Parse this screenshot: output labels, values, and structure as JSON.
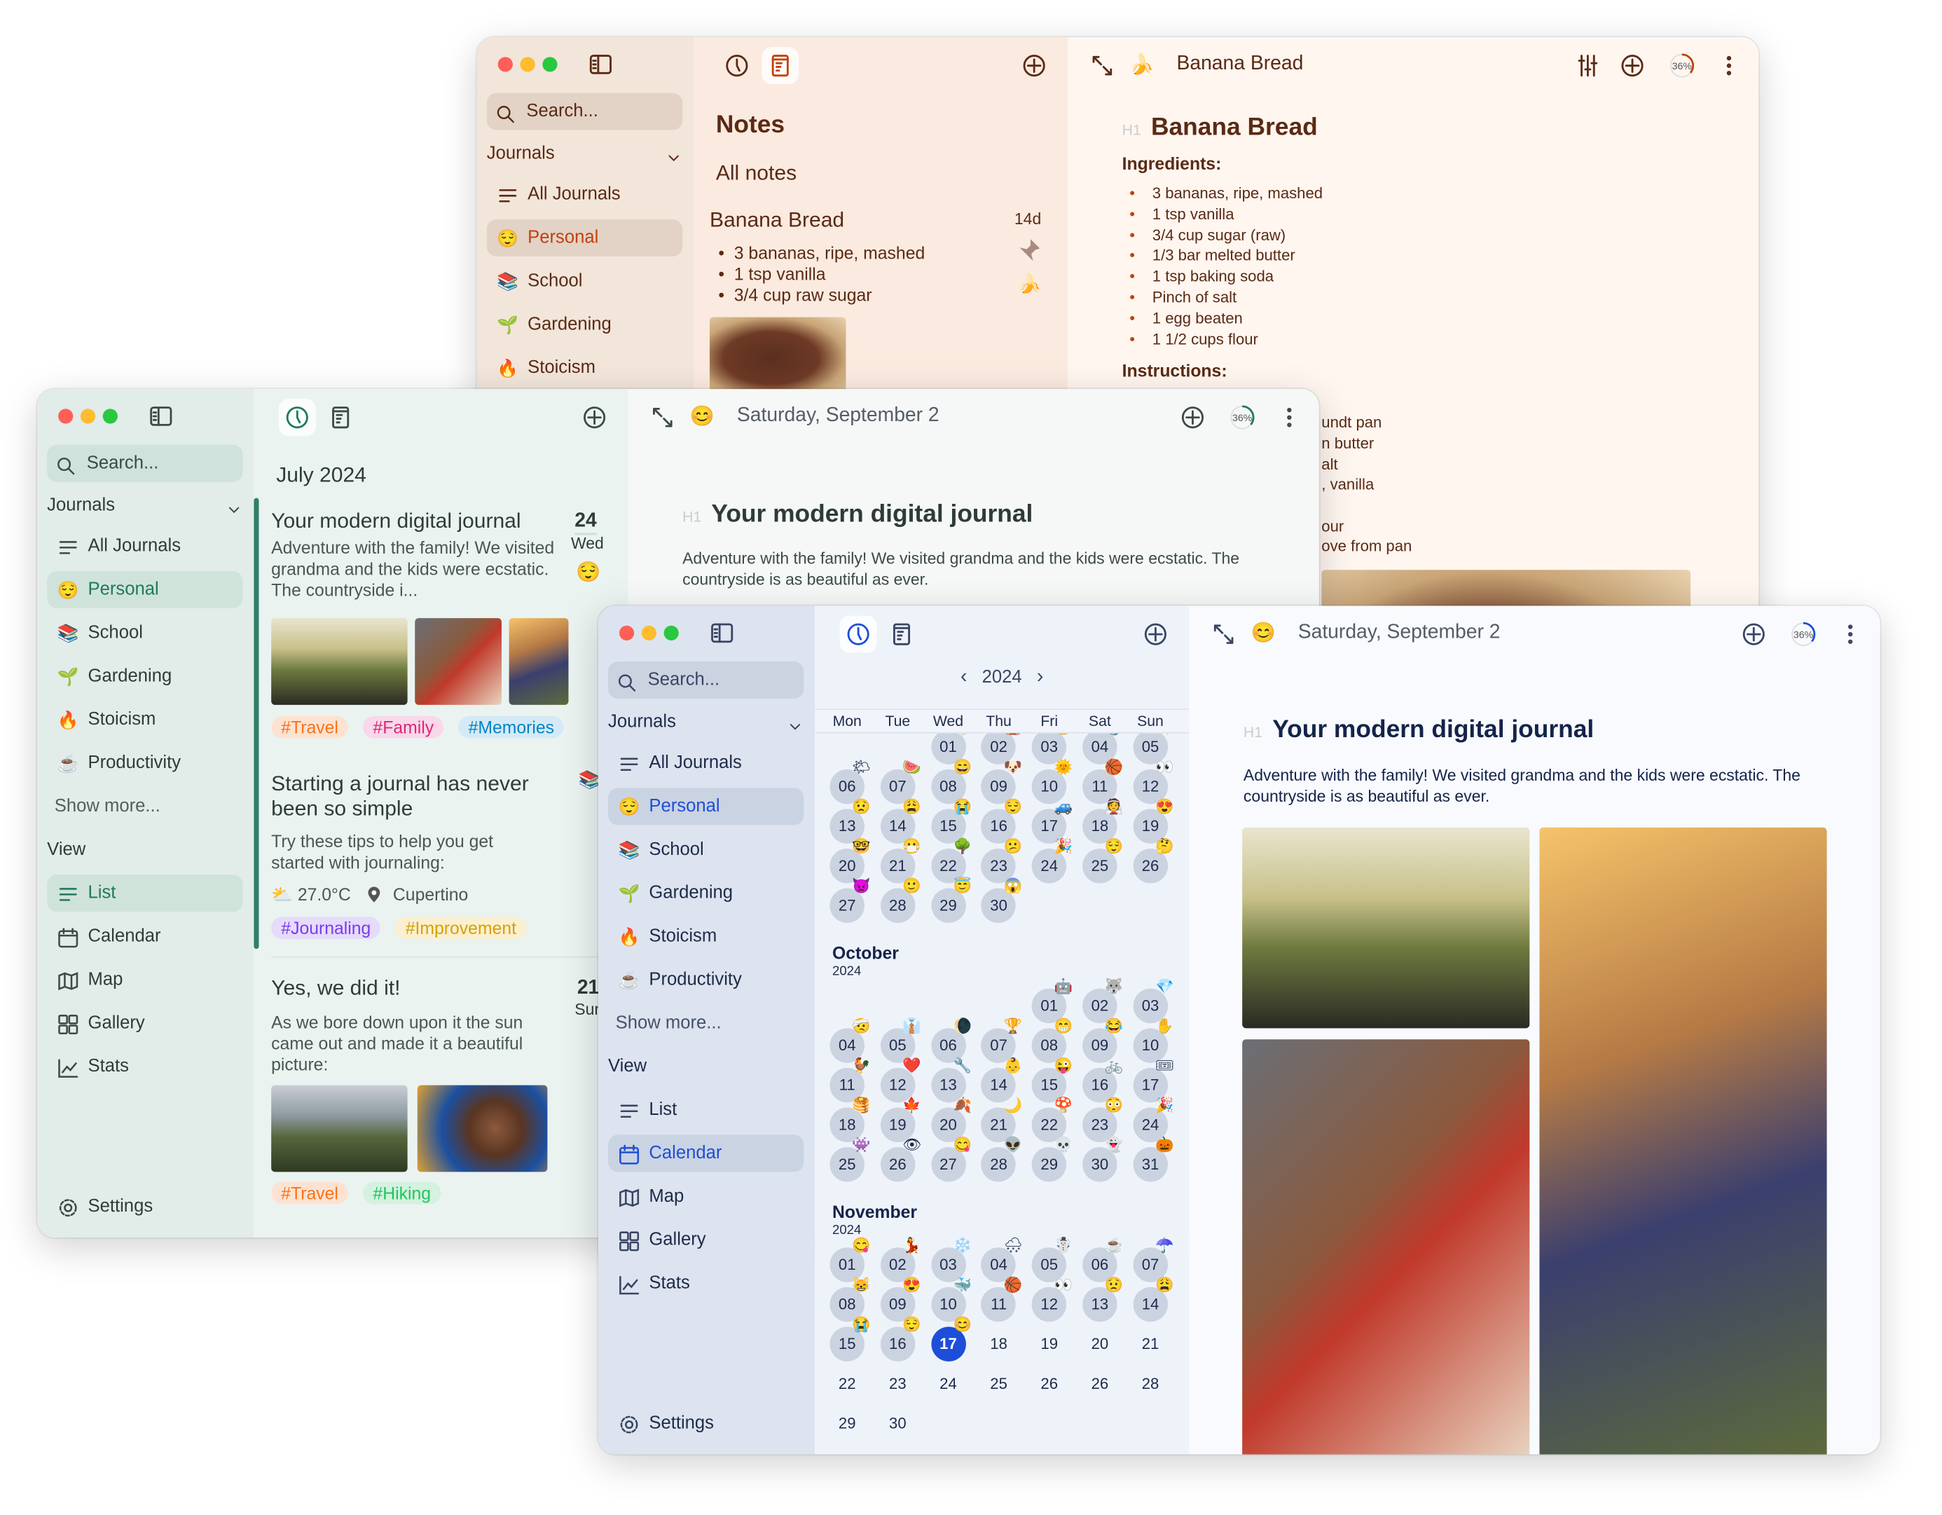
{
  "colors": {
    "brown_accent": "#c2410c",
    "green_accent": "#1f7a5c",
    "blue_accent": "#1d4ed8",
    "traffic_red": "#fe5f57",
    "traffic_yellow": "#febc2e",
    "traffic_green": "#28c840"
  },
  "windows": {
    "notes": {
      "sidebar": {
        "search_placeholder": "Search...",
        "journals_header": "Journals",
        "journals": [
          {
            "label": "All Journals",
            "icon": "list-icon"
          },
          {
            "label": "Personal",
            "icon": "😌",
            "selected": true
          },
          {
            "label": "School",
            "icon": "📚"
          },
          {
            "label": "Gardening",
            "icon": "🌱"
          },
          {
            "label": "Stoicism",
            "icon": "🔥"
          }
        ]
      },
      "middle": {
        "active_tab": "notes",
        "title": "Notes",
        "subtitle": "All notes",
        "note": {
          "title": "Banana Bread",
          "age": "14d",
          "emoji": "🍌",
          "pinned": true,
          "bullets": [
            "3 bananas, ripe, mashed",
            "1 tsp vanilla",
            "3/4 cup raw sugar"
          ]
        }
      },
      "editor": {
        "emoji": "🍌",
        "title": "Banana Bread",
        "progress_label": "36%",
        "progress": 36,
        "h1_marker": "H1",
        "heading": "Banana Bread",
        "ingredients_label": "Ingredients:",
        "ingredients": [
          "3 bananas, ripe, mashed",
          "1 tsp vanilla",
          "3/4 cup sugar (raw)",
          "1/3 bar melted butter",
          "1 tsp baking soda",
          "Pinch of salt",
          "1 egg beaten",
          "1 1/2 cups flour"
        ],
        "instructions_label": "Instructions:",
        "instruction_fragments": [
          "undt pan",
          "n butter",
          "alt",
          ", vanilla",
          "our",
          "ove from pan"
        ]
      }
    },
    "journal": {
      "sidebar": {
        "search_placeholder": "Search...",
        "journals_header": "Journals",
        "journals": [
          {
            "label": "All Journals",
            "icon": "list-icon"
          },
          {
            "label": "Personal",
            "icon": "😌",
            "selected": true
          },
          {
            "label": "School",
            "icon": "📚"
          },
          {
            "label": "Gardening",
            "icon": "🌱"
          },
          {
            "label": "Stoicism",
            "icon": "🔥"
          },
          {
            "label": "Productivity",
            "icon": "☕"
          }
        ],
        "show_more": "Show more...",
        "view_header": "View",
        "views": [
          {
            "label": "List",
            "icon": "list-icon",
            "selected": true
          },
          {
            "label": "Calendar",
            "icon": "calendar-icon"
          },
          {
            "label": "Map",
            "icon": "map-icon"
          },
          {
            "label": "Gallery",
            "icon": "gallery-icon"
          },
          {
            "label": "Stats",
            "icon": "stats-icon"
          }
        ],
        "settings": "Settings"
      },
      "middle": {
        "active_tab": "timeline",
        "month_header": "July 2024",
        "entries": [
          {
            "title": "Your modern digital journal",
            "day": "24",
            "weekday": "Wed",
            "mood": "😌",
            "body": "Adventure with the family! We visited grandma and the kids were ecstatic. The countryside i...",
            "photos": [
              "father-daughter",
              "grandma-baking",
              "girls-reading"
            ],
            "tags": [
              {
                "label": "#Travel",
                "color": "#f97316",
                "bg": "#fde2d2"
              },
              {
                "label": "#Family",
                "color": "#db2777",
                "bg": "#f8d8ea"
              },
              {
                "label": "#Memories",
                "color": "#0284c7",
                "bg": "#d4eaf6"
              }
            ]
          },
          {
            "title": "Starting a journal has never been so simple",
            "mood": "📚",
            "body": "Try these tips to help you get started with journaling:",
            "weather": "27.0°C",
            "location": "Cupertino",
            "tags": [
              {
                "label": "#Journaling",
                "color": "#7c3aed",
                "bg": "#e5dbfa"
              },
              {
                "label": "#Improvement",
                "color": "#d4a106",
                "bg": "#faf0d0"
              }
            ]
          },
          {
            "title": "Yes, we did it!",
            "day": "21",
            "weekday": "Sun",
            "body": "As we bore down upon it the sun came out and made it a beautiful picture:",
            "photos": [
              "hikers-mountains",
              "smiling-woman"
            ],
            "tags": [
              {
                "label": "#Travel",
                "color": "#f97316",
                "bg": "#fde2d2"
              },
              {
                "label": "#Hiking",
                "color": "#22c55e",
                "bg": "#d3f2df"
              }
            ]
          }
        ]
      },
      "editor": {
        "emoji": "😊",
        "title": "Saturday, September 2",
        "progress_label": "36%",
        "progress": 36,
        "h1_marker": "H1",
        "heading": "Your modern digital journal",
        "body": "Adventure with the family! We visited grandma and the kids were ecstatic. The countryside is as beautiful as ever."
      }
    },
    "calendar": {
      "sidebar": {
        "search_placeholder": "Search...",
        "journals_header": "Journals",
        "journals": [
          {
            "label": "All Journals",
            "icon": "list-icon"
          },
          {
            "label": "Personal",
            "icon": "😌",
            "selected": true
          },
          {
            "label": "School",
            "icon": "📚"
          },
          {
            "label": "Gardening",
            "icon": "🌱"
          },
          {
            "label": "Stoicism",
            "icon": "🔥"
          },
          {
            "label": "Productivity",
            "icon": "☕"
          }
        ],
        "show_more": "Show more...",
        "view_header": "View",
        "views": [
          {
            "label": "List",
            "icon": "list-icon"
          },
          {
            "label": "Calendar",
            "icon": "calendar-icon",
            "selected": true
          },
          {
            "label": "Map",
            "icon": "map-icon"
          },
          {
            "label": "Gallery",
            "icon": "gallery-icon"
          },
          {
            "label": "Stats",
            "icon": "stats-icon"
          }
        ],
        "settings": "Settings"
      },
      "middle": {
        "active_tab": "timeline",
        "year": "2024",
        "weekdays": [
          "Mon",
          "Tue",
          "Wed",
          "Thu",
          "Fri",
          "Sat",
          "Sun"
        ],
        "months": [
          {
            "name": "",
            "year": "",
            "first_weekday": "Wed",
            "days": [
              {
                "label": "01",
                "emoji": "🥛"
              },
              {
                "label": "02",
                "emoji": "🎪"
              },
              {
                "label": "03",
                "emoji": "😯"
              },
              {
                "label": "04",
                "emoji": "⚓"
              },
              {
                "label": "05",
                "emoji": "✨"
              },
              {
                "label": "06",
                "emoji": "🌤"
              },
              {
                "label": "07",
                "emoji": "🍉"
              },
              {
                "label": "08",
                "emoji": "😄"
              },
              {
                "label": "09",
                "emoji": "🐶"
              },
              {
                "label": "10",
                "emoji": "🌞"
              },
              {
                "label": "11",
                "emoji": "🏀"
              },
              {
                "label": "12",
                "emoji": "👀"
              },
              {
                "label": "13",
                "emoji": "😟"
              },
              {
                "label": "14",
                "emoji": "😩"
              },
              {
                "label": "15",
                "emoji": "😭"
              },
              {
                "label": "16",
                "emoji": "😌"
              },
              {
                "label": "17",
                "emoji": "🚙"
              },
              {
                "label": "18",
                "emoji": "👰"
              },
              {
                "label": "19",
                "emoji": "😍"
              },
              {
                "label": "20",
                "emoji": "🤓"
              },
              {
                "label": "21",
                "emoji": "😷"
              },
              {
                "label": "22",
                "emoji": "🌳"
              },
              {
                "label": "23",
                "emoji": "😕"
              },
              {
                "label": "24",
                "emoji": "🎉"
              },
              {
                "label": "25",
                "emoji": "😌"
              },
              {
                "label": "26",
                "emoji": "🤔"
              },
              {
                "label": "27",
                "emoji": "👿"
              },
              {
                "label": "28",
                "emoji": "🙂"
              },
              {
                "label": "29",
                "emoji": "😇"
              },
              {
                "label": "30",
                "emoji": "😱"
              }
            ]
          },
          {
            "name": "October",
            "year": "2024",
            "first_weekday": "Fri",
            "days": [
              {
                "label": "01",
                "emoji": "🤖"
              },
              {
                "label": "02",
                "emoji": "🐺"
              },
              {
                "label": "03",
                "emoji": "💎"
              },
              {
                "label": "04",
                "emoji": "🤕"
              },
              {
                "label": "05",
                "emoji": "👔"
              },
              {
                "label": "06",
                "emoji": "🌘"
              },
              {
                "label": "07",
                "emoji": "🏆"
              },
              {
                "label": "08",
                "emoji": "😁"
              },
              {
                "label": "09",
                "emoji": "😂"
              },
              {
                "label": "10",
                "emoji": "✋"
              },
              {
                "label": "11",
                "emoji": "🐓"
              },
              {
                "label": "12",
                "emoji": "❤️"
              },
              {
                "label": "13",
                "emoji": "🔧"
              },
              {
                "label": "14",
                "emoji": "👶"
              },
              {
                "label": "15",
                "emoji": "😜"
              },
              {
                "label": "16",
                "emoji": "🚲"
              },
              {
                "label": "17",
                "emoji": "🎟"
              },
              {
                "label": "18",
                "emoji": "🥞"
              },
              {
                "label": "19",
                "emoji": "🍁"
              },
              {
                "label": "20",
                "emoji": "🍂"
              },
              {
                "label": "21",
                "emoji": "🌙"
              },
              {
                "label": "22",
                "emoji": "🍄"
              },
              {
                "label": "23",
                "emoji": "😳"
              },
              {
                "label": "24",
                "emoji": "🎉"
              },
              {
                "label": "25",
                "emoji": "👾"
              },
              {
                "label": "26",
                "emoji": "👁"
              },
              {
                "label": "27",
                "emoji": "😋"
              },
              {
                "label": "28",
                "emoji": "👽"
              },
              {
                "label": "29",
                "emoji": "💀"
              },
              {
                "label": "30",
                "emoji": "👻"
              },
              {
                "label": "31",
                "emoji": "🎃"
              }
            ]
          },
          {
            "name": "November",
            "year": "2024",
            "first_weekday": "Mon",
            "days": [
              {
                "label": "01",
                "emoji": "😋"
              },
              {
                "label": "02",
                "emoji": "💃"
              },
              {
                "label": "03",
                "emoji": "❄️"
              },
              {
                "label": "04",
                "emoji": "🌨"
              },
              {
                "label": "05",
                "emoji": "☃️"
              },
              {
                "label": "06",
                "emoji": "☕"
              },
              {
                "label": "07",
                "emoji": "☂️"
              },
              {
                "label": "08",
                "emoji": "😸"
              },
              {
                "label": "09",
                "emoji": "😍"
              },
              {
                "label": "10",
                "emoji": "🐳"
              },
              {
                "label": "11",
                "emoji": "🏀"
              },
              {
                "label": "12",
                "emoji": "👀"
              },
              {
                "label": "13",
                "emoji": "😟"
              },
              {
                "label": "14",
                "emoji": "😩"
              },
              {
                "label": "15",
                "emoji": "😭"
              },
              {
                "label": "16",
                "emoji": "😌"
              },
              {
                "label": "17",
                "emoji": "😊",
                "selected": true
              },
              {
                "label": "18"
              },
              {
                "label": "19"
              },
              {
                "label": "20"
              },
              {
                "label": "21"
              },
              {
                "label": "22"
              },
              {
                "label": "23"
              },
              {
                "label": "24"
              },
              {
                "label": "25"
              },
              {
                "label": "26"
              },
              {
                "label": "26"
              },
              {
                "label": "28"
              },
              {
                "label": "29"
              },
              {
                "label": "30"
              }
            ]
          }
        ]
      },
      "editor": {
        "emoji": "😊",
        "title": "Saturday, September 2",
        "progress_label": "36%",
        "progress": 36,
        "h1_marker": "H1",
        "heading": "Your modern digital journal",
        "body": "Adventure with the family! We visited grandma and the kids were ecstatic. The countryside is as beautiful as ever.",
        "photos": [
          "father-daughter",
          "grandma-baking",
          "girls-reading"
        ]
      }
    }
  }
}
